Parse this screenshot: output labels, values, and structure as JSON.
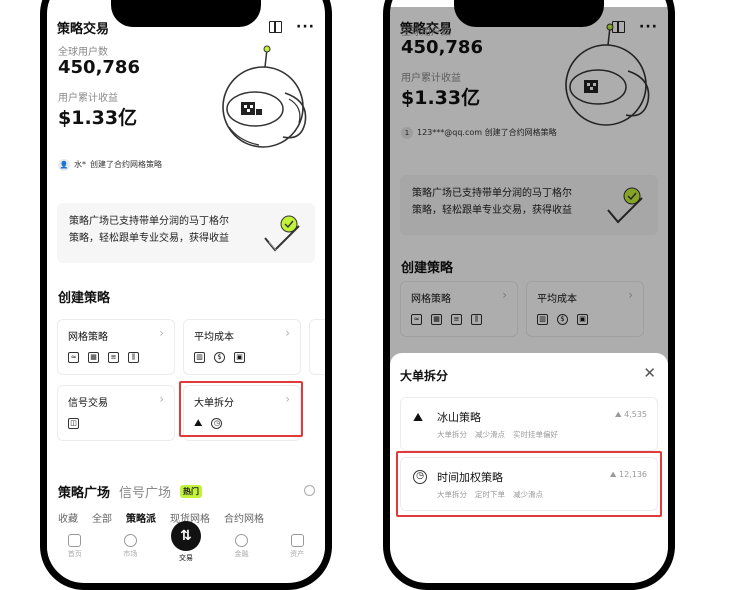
{
  "app": {
    "title": "策略交易"
  },
  "stats": {
    "users_label": "全球用户数",
    "users_value": "450,786",
    "earnings_label": "用户累计收益",
    "earnings_value": "$1.33亿"
  },
  "activity": {
    "left_user": "水*",
    "left_text": "创建了合约网格策略",
    "right_user": "1",
    "right_text": "123***@qq.com 创建了合约网格策略"
  },
  "banner": {
    "line1": "策略广场已支持带单分润的马丁格尔",
    "line2": "策略，轻松跟单专业交易，获得收益"
  },
  "create": {
    "title": "创建策略",
    "cards": [
      {
        "label": "网格策略"
      },
      {
        "label": "平均成本"
      },
      {
        "label": "信号交易"
      },
      {
        "label": "大单拆分"
      }
    ]
  },
  "plaza": {
    "tab_active": "策略广场",
    "tab_other": "信号广场",
    "hot_badge": "热门",
    "filters": [
      "收藏",
      "全部",
      "策略派",
      "现货网格",
      "合约网格"
    ]
  },
  "nav": {
    "items": [
      "首页",
      "市场",
      "交易",
      "金融",
      "资产"
    ],
    "center_glyph": "⇅"
  },
  "sheet": {
    "title": "大单拆分",
    "close_glyph": "✕",
    "items": [
      {
        "name": "冰山策略",
        "tags": [
          "大单拆分",
          "减少滑点",
          "实时挂单偏好"
        ],
        "count": "4,535"
      },
      {
        "name": "时间加权策略",
        "tags": [
          "大单拆分",
          "定时下单",
          "减少滑点"
        ],
        "count": "12,136"
      }
    ]
  },
  "colors": {
    "accent_hot": "#c3f23b",
    "highlight_box": "#e03a3a"
  }
}
